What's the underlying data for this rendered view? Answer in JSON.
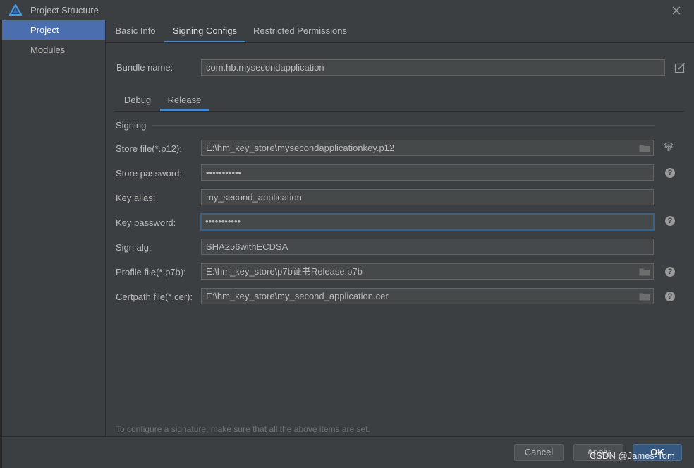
{
  "window": {
    "title": "Project Structure"
  },
  "sidebar": {
    "items": [
      {
        "label": "Project"
      },
      {
        "label": "Modules"
      }
    ]
  },
  "tabs": [
    {
      "label": "Basic Info"
    },
    {
      "label": "Signing Configs"
    },
    {
      "label": "Restricted Permissions"
    }
  ],
  "bundle": {
    "label": "Bundle name:",
    "value": "com.hb.mysecondapplication"
  },
  "subtabs": [
    {
      "label": "Debug"
    },
    {
      "label": "Release"
    }
  ],
  "signing": {
    "section_title": "Signing",
    "store_file": {
      "label": "Store file(*.p12):",
      "value": "E:\\hm_key_store\\mysecondapplicationkey.p12"
    },
    "store_password": {
      "label": "Store password:",
      "value": "•••••••••••"
    },
    "key_alias": {
      "label": "Key alias:",
      "value": "my_second_application"
    },
    "key_password": {
      "label": "Key password:",
      "value": "•••••••••••"
    },
    "sign_alg": {
      "label": "Sign alg:",
      "value": "SHA256withECDSA"
    },
    "profile_file": {
      "label": "Profile file(*.p7b):",
      "value": "E:\\hm_key_store\\p7b证书Release.p7b"
    },
    "certpath_file": {
      "label": "Certpath file(*.cer):",
      "value": "E:\\hm_key_store\\my_second_application.cer"
    }
  },
  "note": "To configure a signature, make sure that all the above items are set.",
  "buttons": {
    "cancel": "Cancel",
    "apply": "Apply",
    "ok": "OK"
  },
  "watermark": "CSDN @James-Tom",
  "colors": {
    "accent": "#4a88c7",
    "selection": "#4b6eaf",
    "background": "#3c3f41",
    "primary_button": "#365880"
  }
}
